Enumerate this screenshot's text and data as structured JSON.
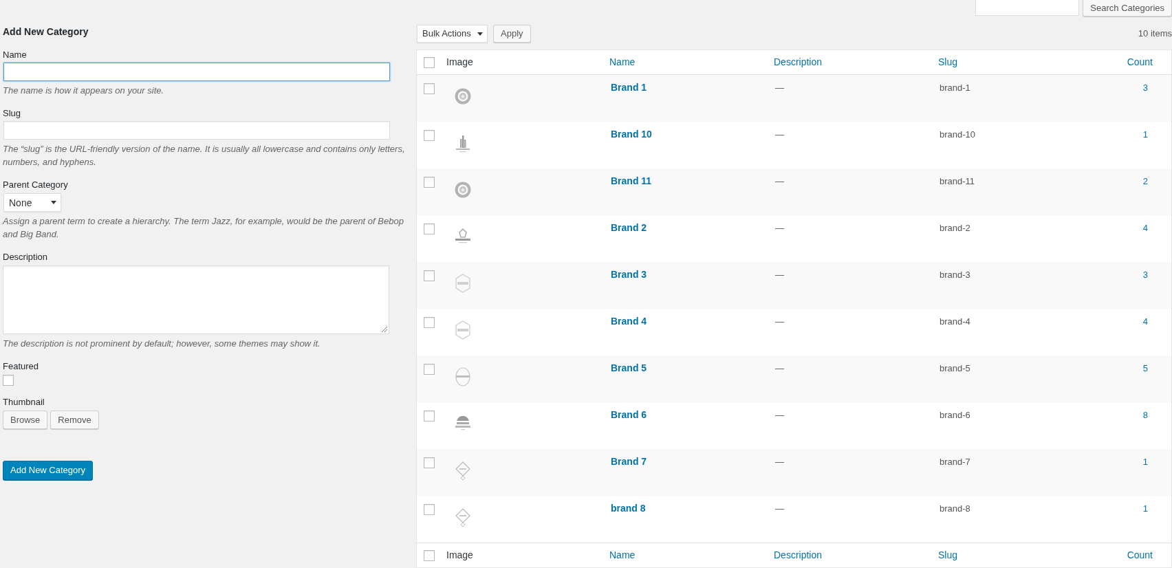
{
  "search": {
    "button": "Search Categories"
  },
  "form": {
    "title": "Add New Category",
    "fields": [
      {
        "kind": "text",
        "label": "Name",
        "focused": true,
        "hint": "The name is how it appears on your site."
      },
      {
        "kind": "text",
        "label": "Slug",
        "focused": false,
        "hint": "The “slug” is the URL-friendly version of the name. It is usually all lowercase and contains only letters, numbers, and hyphens."
      },
      {
        "kind": "select",
        "label": "Parent Category",
        "value": "None",
        "hint": "Assign a parent term to create a hierarchy. The term Jazz, for example, would be the parent of Bebop and Big Band."
      },
      {
        "kind": "textarea",
        "label": "Description",
        "hint": "The description is not prominent by default; however, some themes may show it."
      },
      {
        "kind": "checkbox",
        "label": "Featured",
        "checked": false
      },
      {
        "kind": "buttons",
        "label": "Thumbnail",
        "buttons": [
          "Browse",
          "Remove"
        ]
      }
    ],
    "submit": "Add New Category"
  },
  "bulk_actions": {
    "value": "Bulk Actions",
    "button": "Apply"
  },
  "item_count": "10 items",
  "table": {
    "header": {
      "checked": false,
      "columns": [
        {
          "label": "Image",
          "sortable": false
        },
        {
          "label": "Name",
          "sortable": true
        },
        {
          "label": "Description",
          "sortable": true
        },
        {
          "label": "Slug",
          "sortable": true
        },
        {
          "label": "Count",
          "sortable": true
        }
      ]
    },
    "rows": [
      {
        "checked": false,
        "kind": "seal",
        "name": "Brand 1",
        "description": "—",
        "slug": "brand-1",
        "count": "3"
      },
      {
        "checked": false,
        "kind": "skyline",
        "name": "Brand 10",
        "description": "—",
        "slug": "brand-10",
        "count": "1"
      },
      {
        "checked": false,
        "kind": "seal",
        "name": "Brand 11",
        "description": "—",
        "slug": "brand-11",
        "count": "2"
      },
      {
        "checked": false,
        "kind": "crest",
        "name": "Brand 2",
        "description": "—",
        "slug": "brand-2",
        "count": "4"
      },
      {
        "checked": false,
        "kind": "hexagon",
        "name": "Brand 3",
        "description": "—",
        "slug": "brand-3",
        "count": "3"
      },
      {
        "checked": false,
        "kind": "hexagon",
        "name": "Brand 4",
        "description": "—",
        "slug": "brand-4",
        "count": "4"
      },
      {
        "checked": false,
        "kind": "oval",
        "name": "Brand 5",
        "description": "—",
        "slug": "brand-5",
        "count": "5"
      },
      {
        "checked": false,
        "kind": "tree",
        "name": "Brand 6",
        "description": "—",
        "slug": "brand-6",
        "count": "8"
      },
      {
        "checked": false,
        "kind": "diamond",
        "name": "Brand 7",
        "description": "—",
        "slug": "brand-7",
        "count": "1"
      },
      {
        "checked": false,
        "kind": "diamond",
        "name": "brand 8",
        "description": "—",
        "slug": "brand-8",
        "count": "1"
      }
    ],
    "footer": {
      "checked": false,
      "columns": [
        {
          "label": "Image",
          "sortable": false
        },
        {
          "label": "Name",
          "sortable": true
        },
        {
          "label": "Description",
          "sortable": true
        },
        {
          "label": "Slug",
          "sortable": true
        },
        {
          "label": "Count",
          "sortable": true
        }
      ]
    }
  }
}
